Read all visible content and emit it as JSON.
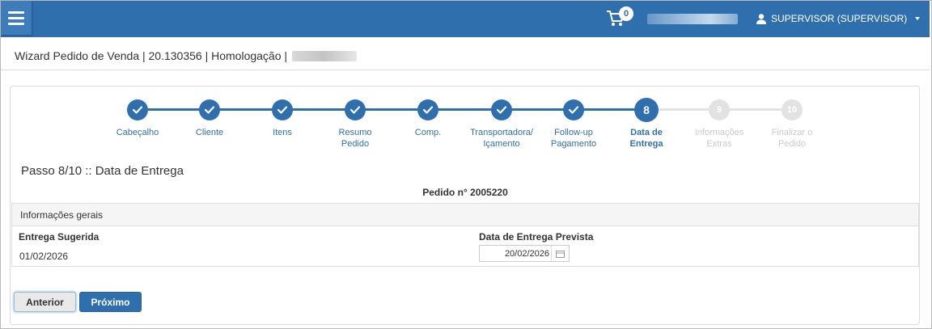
{
  "header": {
    "cart_count": "0",
    "user_label": "SUPERVISOR (SUPERVISOR)"
  },
  "page": {
    "title": "Wizard Pedido de Venda | 20.130356 | Homologação |"
  },
  "wizard": {
    "steps": [
      {
        "number": "1",
        "label": "Cabeçalho",
        "state": "done"
      },
      {
        "number": "2",
        "label": "Cliente",
        "state": "done"
      },
      {
        "number": "3",
        "label": "Itens",
        "state": "done"
      },
      {
        "number": "4",
        "label": "Resumo\nPedido",
        "state": "done"
      },
      {
        "number": "5",
        "label": "Comp.",
        "state": "done"
      },
      {
        "number": "6",
        "label": "Transportadora/\nIçamento",
        "state": "done"
      },
      {
        "number": "7",
        "label": "Follow-up\nPagamento",
        "state": "done"
      },
      {
        "number": "8",
        "label": "Data de\nEntrega",
        "state": "current"
      },
      {
        "number": "9",
        "label": "Informações\nExtras",
        "state": "todo"
      },
      {
        "number": "10",
        "label": "Finalizar o\nPedido",
        "state": "todo"
      }
    ],
    "step_title": "Passo 8/10 :: Data de Entrega",
    "order_number": "Pedido n° 2005220"
  },
  "section": {
    "title": "Informações gerais",
    "suggested_label": "Entrega Sugerida",
    "suggested_value": "01/02/2026",
    "expected_label": "Data de Entrega Prevista",
    "expected_value": "20/02/2026"
  },
  "buttons": {
    "previous": "Anterior",
    "next": "Próximo"
  },
  "colors": {
    "primary": "#2f6fae",
    "inactive": "#e2e2e2"
  }
}
